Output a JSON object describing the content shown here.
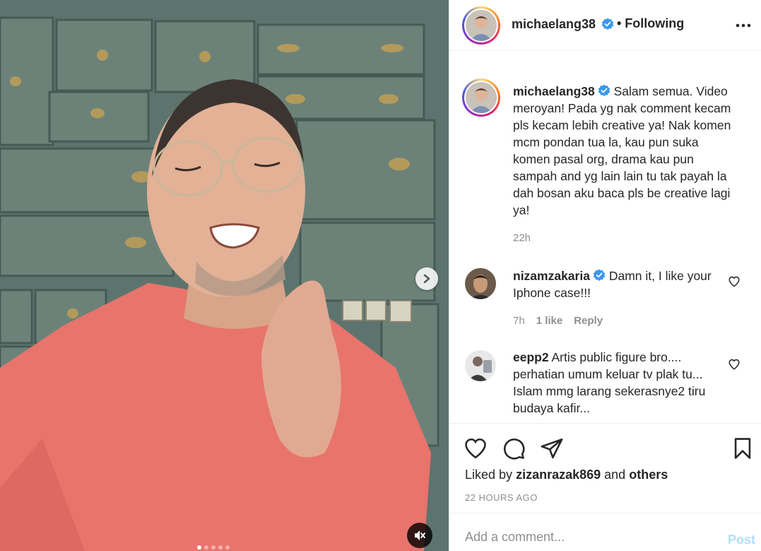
{
  "post": {
    "username": "michaelang38",
    "verified": true,
    "follow_status": "• Following",
    "more_icon": "more-horizontal-icon"
  },
  "media": {
    "type": "video",
    "carousel_dots": 5,
    "active_dot": 0,
    "next_icon": "chevron-right-icon",
    "mute_icon": "muted-speaker-icon"
  },
  "caption": {
    "username": "michaelang38",
    "text": "Salam semua. Video meroyan! Pada yg nak comment kecam pls kecam lebih creative ya! Nak komen mcm pondan tua la, kau pun suka komen pasal org, drama kau pun sampah and yg lain lain tu tak payah la dah bosan aku baca pls be creative lagi ya!",
    "time": "22h"
  },
  "comments": [
    {
      "username": "nizamzakaria",
      "verified": true,
      "text": "Damn it, I like your Iphone case!!!",
      "time": "7h",
      "likes": "1 like",
      "reply": "Reply"
    },
    {
      "username": "eepp2",
      "verified": false,
      "text": "Artis public figure bro.... perhatian umum keluar tv plak tu... Islam mmg larang sekerasnye2 tiru budaya kafir..."
    }
  ],
  "actions": {
    "liked_prefix": "Liked by",
    "liked_user": "zizanrazak869",
    "liked_and": "and",
    "liked_others": "others",
    "time_ago": "22 HOURS AGO"
  },
  "add_comment": {
    "placeholder": "Add a comment...",
    "post_label": "Post"
  },
  "colors": {
    "verified_blue": "#3897f0",
    "post_disabled": "#b2dffc",
    "muted_text": "#8e8e8e",
    "shirt": "#e8746c"
  }
}
